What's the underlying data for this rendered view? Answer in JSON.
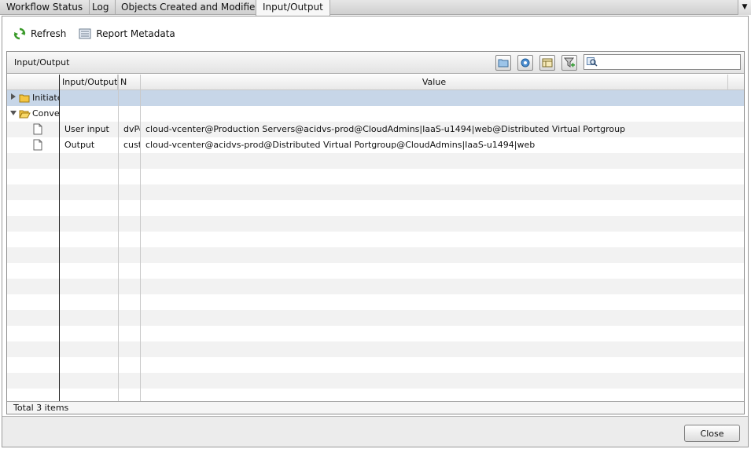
{
  "tabs": [
    {
      "label": "Workflow Status",
      "active": false
    },
    {
      "label": "Log",
      "active": false
    },
    {
      "label": "Objects Created and Modified",
      "active": false
    },
    {
      "label": "Input/Output",
      "active": true
    }
  ],
  "toolbar": {
    "refresh_label": "Refresh",
    "report_metadata_label": "Report Metadata"
  },
  "panel": {
    "title": "Input/Output",
    "search": {
      "value": "",
      "placeholder": ""
    }
  },
  "grid": {
    "columns": [
      "",
      "Input/Output",
      "N",
      "Value"
    ],
    "rows": [
      {
        "name": "Initiate",
        "type": "",
        "n": "",
        "value": "",
        "kind": "folder",
        "expanded": false,
        "selected": true
      },
      {
        "name": "Convert",
        "type": "",
        "n": "",
        "value": "",
        "kind": "folder",
        "expanded": true,
        "selected": false
      },
      {
        "name": "",
        "type": "User input",
        "n": "dvPortgroup",
        "value": "cloud-vcenter@Production Servers@acidvs-prod@CloudAdmins|IaaS-u1494|web@Distributed Virtual Portgroup",
        "kind": "file",
        "selected": false
      },
      {
        "name": "",
        "type": "Output",
        "n": "custom",
        "value": "cloud-vcenter@acidvs-prod@Distributed Virtual Portgroup@CloudAdmins|IaaS-u1494|web",
        "kind": "file",
        "selected": false
      }
    ],
    "footer": "Total 3 items"
  },
  "close_label": "Close",
  "colors": {
    "selected_row": "#c7d6e8",
    "stripe": "#f2f2f2"
  }
}
